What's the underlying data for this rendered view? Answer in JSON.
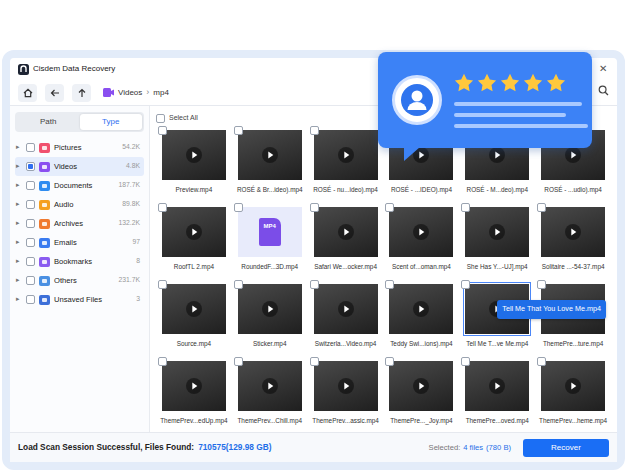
{
  "window": {
    "title": "Cisdem Data Recovery",
    "close": "✕"
  },
  "toolbar": {
    "breadcrumb": [
      {
        "label": "Videos"
      },
      {
        "label": "mp4"
      }
    ],
    "separator": "›"
  },
  "sidebar": {
    "tabs": [
      {
        "label": "Path",
        "selected": false
      },
      {
        "label": "Type",
        "selected": true
      }
    ],
    "expander": "▸",
    "items": [
      {
        "label": "Pictures",
        "count": "54.2K",
        "checked": false,
        "partial": false,
        "selected": false,
        "color": "#f0506e"
      },
      {
        "label": "Videos",
        "count": "4.8K",
        "checked": false,
        "partial": true,
        "selected": true,
        "color": "#8a4ff0"
      },
      {
        "label": "Documents",
        "count": "187.7K",
        "checked": false,
        "partial": false,
        "selected": false,
        "color": "#2f8cf0"
      },
      {
        "label": "Audio",
        "count": "89.8K",
        "checked": false,
        "partial": false,
        "selected": false,
        "color": "#f5a020"
      },
      {
        "label": "Archives",
        "count": "132.2K",
        "checked": false,
        "partial": false,
        "selected": false,
        "color": "#f07a30"
      },
      {
        "label": "Emails",
        "count": "97",
        "checked": false,
        "partial": false,
        "selected": false,
        "color": "#3a7bf0"
      },
      {
        "label": "Bookmarks",
        "count": "8",
        "checked": false,
        "partial": false,
        "selected": false,
        "color": "#8a5cf0"
      },
      {
        "label": "Others",
        "count": "231.7K",
        "checked": false,
        "partial": false,
        "selected": false,
        "color": "#4a90e2"
      },
      {
        "label": "Unsaved Files",
        "count": "3",
        "checked": false,
        "partial": false,
        "selected": false,
        "color": "#3d6fd8"
      }
    ]
  },
  "select_all": {
    "label": "Select All",
    "checked": false
  },
  "files": [
    {
      "label": "Preview.mp4",
      "kind": "video",
      "checked": false,
      "hovered": false
    },
    {
      "label": "ROSÉ & Br...ideo).mp4",
      "kind": "video",
      "checked": false,
      "hovered": false
    },
    {
      "label": "ROSÉ - nu...ideo).mp4",
      "kind": "video",
      "checked": false,
      "hovered": false
    },
    {
      "label": "ROSÉ - ...IDEO).mp4",
      "kind": "video",
      "checked": false,
      "hovered": false
    },
    {
      "label": "ROSÉ - M...deo).mp4",
      "kind": "video",
      "checked": false,
      "hovered": false
    },
    {
      "label": "ROSÉ - ...udio).mp4",
      "kind": "video",
      "checked": false,
      "hovered": false
    },
    {
      "label": "RoofTL 2.mp4",
      "kind": "video",
      "checked": false,
      "hovered": false
    },
    {
      "label": "RoundedF...3D.mp4",
      "kind": "file",
      "badge": "MP4",
      "checked": false,
      "hovered": false
    },
    {
      "label": "Safari We...ocker.mp4",
      "kind": "video",
      "checked": false,
      "hovered": false
    },
    {
      "label": "Scent of...oman.mp4",
      "kind": "video",
      "checked": false,
      "hovered": false
    },
    {
      "label": "She Has Y...-UJ].mp4",
      "kind": "video",
      "checked": false,
      "hovered": false
    },
    {
      "label": "Solitaire ...-54-37.mp4",
      "kind": "video",
      "checked": false,
      "hovered": false
    },
    {
      "label": "Source.mp4",
      "kind": "video",
      "checked": false,
      "hovered": false
    },
    {
      "label": "Sticker.mp4",
      "kind": "video",
      "checked": false,
      "hovered": false
    },
    {
      "label": "Switzerla...Video.mp4",
      "kind": "video",
      "checked": false,
      "hovered": false
    },
    {
      "label": "Teddy Swi...ions).mp4",
      "kind": "video",
      "checked": false,
      "hovered": false
    },
    {
      "label": "Tell Me T...ve Me.mp4",
      "kind": "video",
      "checked": false,
      "hovered": true
    },
    {
      "label": "ThemePre...ture.mp4",
      "kind": "video",
      "checked": false,
      "hovered": false
    },
    {
      "label": "ThemePrev...edUp.mp4",
      "kind": "video",
      "checked": false,
      "hovered": false
    },
    {
      "label": "ThemePrev...Chill.mp4",
      "kind": "video",
      "checked": false,
      "hovered": false
    },
    {
      "label": "ThemePrev...assic.mp4",
      "kind": "video",
      "checked": false,
      "hovered": false
    },
    {
      "label": "ThemePre..._Joy.mp4",
      "kind": "video",
      "checked": false,
      "hovered": false
    },
    {
      "label": "ThemePre...oved.mp4",
      "kind": "video",
      "checked": false,
      "hovered": false
    },
    {
      "label": "ThemePrev...heme.mp4",
      "kind": "video",
      "checked": false,
      "hovered": false
    }
  ],
  "tooltip": {
    "text": "Tell Me That You Love Me.mp4"
  },
  "status_bar": {
    "label": "Load Scan Session Successful, Files Found:",
    "count": "710575",
    "size": "(129.98 GB)",
    "selected_label": "Selected:",
    "selected_count": "4 files",
    "selected_size": "(780 B)",
    "button": "Recover"
  },
  "review_bubble": {
    "stars": 5
  }
}
